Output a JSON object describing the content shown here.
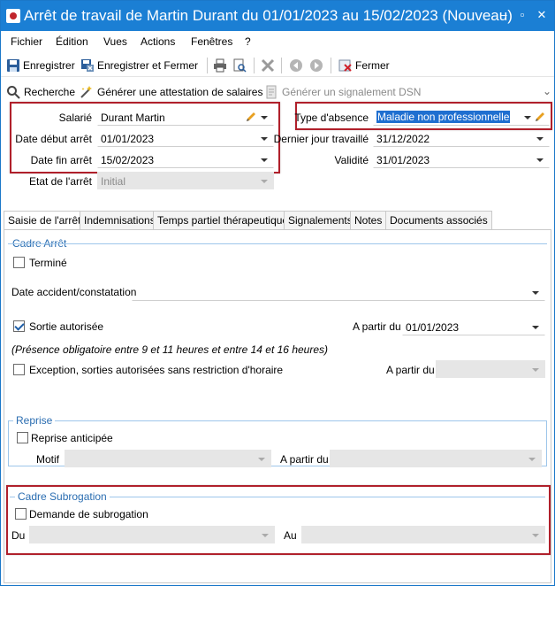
{
  "window": {
    "title": "Arrêt de travail de Martin Durant du 01/01/2023 au 15/02/2023 (Nouveau)",
    "controls": [
      "–",
      "▫",
      "✕"
    ]
  },
  "menu": {
    "items": [
      "Fichier",
      "Édition",
      "Vues",
      "Actions",
      "Fenêtres",
      "?"
    ]
  },
  "toolbar": {
    "save_label": "Enregistrer",
    "save_close_label": "Enregistrer et Fermer",
    "close_label": "Fermer"
  },
  "actionbar": {
    "search_label": "Recherche",
    "attestation_label": "Générer une attestation de salaires",
    "dsn_label": "Générer un signalement DSN"
  },
  "form": {
    "salarie_label": "Salarié",
    "salarie_value": "Durant Martin",
    "date_debut_label": "Date début arrêt",
    "date_debut_value": "01/01/2023",
    "date_fin_label": "Date fin arrêt",
    "date_fin_value": "15/02/2023",
    "etat_label": "Etat de l'arrêt",
    "etat_value": "Initial",
    "type_absence_label": "Type d'absence",
    "type_absence_value": "Maladie non professionnelle",
    "dernier_jour_label": "Dernier jour travaillé",
    "dernier_jour_value": "31/12/2022",
    "validite_label": "Validité",
    "validite_value": "31/01/2023"
  },
  "tabs": [
    "Saisie de l'arrêt",
    "Indemnisations",
    "Temps partiel thérapeutique",
    "Signalements",
    "Notes",
    "Documents associés"
  ],
  "cadre_arret": {
    "title": "Cadre Arrêt",
    "termine_label": "Terminé",
    "date_accident_label": "Date accident/constatation",
    "date_accident_value": "",
    "sortie_label": "Sortie autorisée",
    "sortie_checked": true,
    "a_partir_label": "A partir du",
    "a_partir_value": "01/01/2023",
    "presence_note": "(Présence obligatoire entre 9 et 11 heures et entre 14 et 16 heures)",
    "exception_label": "Exception, sorties autorisées sans restriction d'horaire",
    "a_partir2_label": "A partir du"
  },
  "reprise": {
    "title": "Reprise",
    "anticipee_label": "Reprise anticipée",
    "motif_label": "Motif",
    "a_partir_label": "A partir du"
  },
  "subrogation": {
    "title": "Cadre Subrogation",
    "demande_label": "Demande de subrogation",
    "du_label": "Du",
    "au_label": "Au"
  }
}
